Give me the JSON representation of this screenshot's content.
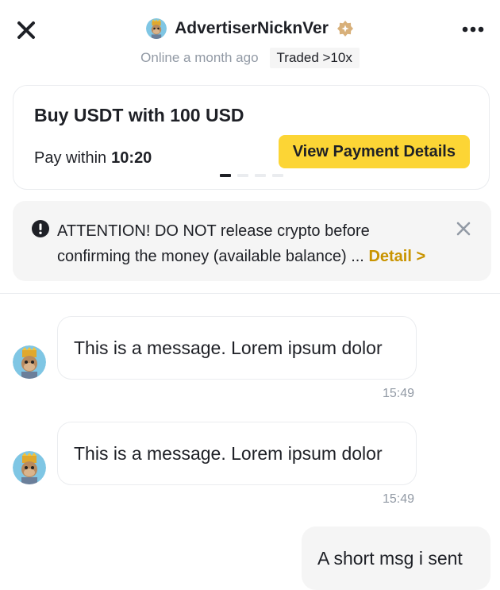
{
  "header": {
    "advertiser_name": "AdvertiserNicknVer",
    "status": "Online a month ago",
    "traded_badge": "Traded >10x",
    "icons": {
      "close": "close-icon",
      "more": "more-icon",
      "merchant": "merchant-badge-icon"
    }
  },
  "order_card": {
    "title": "Buy USDT with 100 USD",
    "pay_within_label": "Pay within",
    "pay_within_time": "10:20",
    "payment_button": "View Payment Details",
    "page_count": 4,
    "active_page": 1
  },
  "attention": {
    "text": "ATTENTION! DO NOT release crypto before confirming the money (available balance) ...",
    "detail_link": "Detail >"
  },
  "messages": [
    {
      "direction": "in",
      "text": "This is a message. Lorem ipsum dolor",
      "time": "15:49"
    },
    {
      "direction": "in",
      "text": "This is a message. Lorem ipsum dolor",
      "time": "15:49"
    },
    {
      "direction": "out",
      "text": "A short msg i sent"
    }
  ],
  "colors": {
    "accent_yellow": "#fcd535",
    "link_gold": "#c99400",
    "text_primary": "#1e2026",
    "text_secondary": "#929aa5",
    "border": "#eaecef",
    "surface_grey": "#f5f5f5"
  }
}
